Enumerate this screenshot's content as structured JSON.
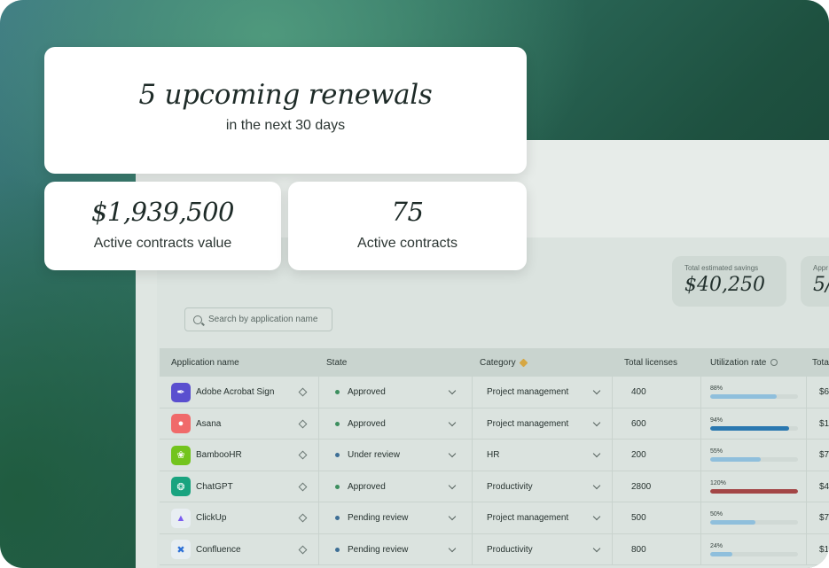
{
  "hero": {
    "title": "5 upcoming renewals",
    "subtitle": "in the next 30 days"
  },
  "cards": [
    {
      "value": "$1,939,500",
      "label": "Active contracts value"
    },
    {
      "value": "75",
      "label": "Active contracts"
    }
  ],
  "stats": [
    {
      "label": "Total estimated savings",
      "value": "$40,250"
    },
    {
      "label": "Appr",
      "value": "5/"
    }
  ],
  "search": {
    "placeholder": "Search by application name"
  },
  "table": {
    "columns": [
      "Application name",
      "State",
      "Category",
      "Total licenses",
      "Utilization rate",
      "Tota"
    ],
    "rows": [
      {
        "name": "Adobe Acrobat Sign",
        "logo": "acrobat-sign-logo",
        "logo_color": "#5a4fcf",
        "state": "Approved",
        "state_color": "#3d8f5f",
        "category": "Project management",
        "licenses": "400",
        "util_label": "88%",
        "util": 0.76,
        "util_color": "#8fbfdc",
        "total": "$6"
      },
      {
        "name": "Asana",
        "logo": "asana-logo",
        "logo_color": "#f06a6a",
        "state": "Approved",
        "state_color": "#3d8f5f",
        "category": "Project management",
        "licenses": "600",
        "util_label": "94%",
        "util": 0.9,
        "util_color": "#2a78b0",
        "total": "$1"
      },
      {
        "name": "BambooHR",
        "logo": "bamboohr-logo",
        "logo_color": "#73c41d",
        "state": "Under review",
        "state_color": "#3e6f96",
        "category": "HR",
        "licenses": "200",
        "util_label": "55%",
        "util": 0.58,
        "util_color": "#8fbfdc",
        "total": "$7"
      },
      {
        "name": "ChatGPT",
        "logo": "chatgpt-logo",
        "logo_color": "#19a37f",
        "state": "Approved",
        "state_color": "#3d8f5f",
        "category": "Productivity",
        "licenses": "2800",
        "util_label": "120%",
        "util": 1.0,
        "util_color": "#a34646",
        "total": "$4"
      },
      {
        "name": "ClickUp",
        "logo": "clickup-logo",
        "logo_color": "#e8eef2",
        "state": "Pending review",
        "state_color": "#3e6f96",
        "category": "Project management",
        "licenses": "500",
        "util_label": "50%",
        "util": 0.52,
        "util_color": "#8fbfdc",
        "total": "$7"
      },
      {
        "name": "Confluence",
        "logo": "confluence-logo",
        "logo_color": "#e8eef2",
        "state": "Pending review",
        "state_color": "#3e6f96",
        "category": "Productivity",
        "licenses": "800",
        "util_label": "24%",
        "util": 0.25,
        "util_color": "#8fbfdc",
        "total": "$1"
      }
    ]
  }
}
